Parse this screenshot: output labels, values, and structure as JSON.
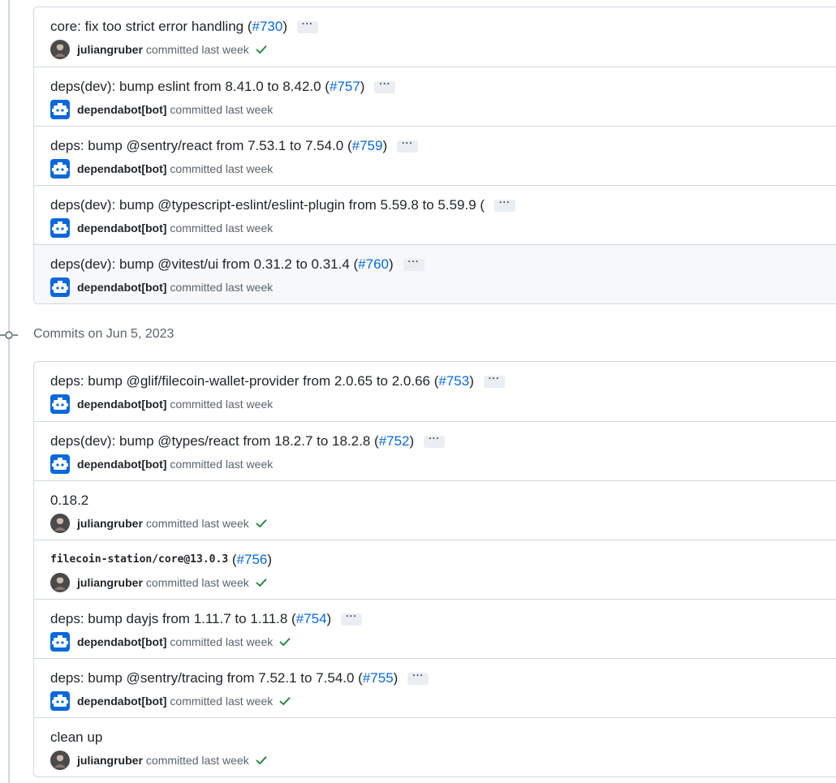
{
  "groups": [
    {
      "header": "",
      "commits": [
        {
          "title": "core: fix too strict error handling (",
          "pr": "#730",
          "close": ")",
          "author": "juliangruber",
          "avatar": "user",
          "status": "committed last week",
          "check": true,
          "ellipsis": "···"
        },
        {
          "title": "deps(dev): bump eslint from 8.41.0 to 8.42.0 (",
          "pr": "#757",
          "close": ")",
          "author": "dependabot[bot]",
          "avatar": "bot",
          "status": "committed last week",
          "check": false,
          "ellipsis": "···"
        },
        {
          "title": "deps: bump @sentry/react from 7.53.1 to 7.54.0 (",
          "pr": "#759",
          "close": ")",
          "author": "dependabot[bot]",
          "avatar": "bot",
          "status": "committed last week",
          "check": false,
          "ellipsis": "···"
        },
        {
          "title": "deps(dev): bump @typescript-eslint/eslint-plugin from 5.59.8 to 5.59.9 (",
          "pr": "",
          "close": "",
          "author": "dependabot[bot]",
          "avatar": "bot",
          "status": "committed last week",
          "check": false,
          "ellipsis": "···"
        },
        {
          "title": "deps(dev): bump @vitest/ui from 0.31.2 to 0.31.4 (",
          "pr": "#760",
          "close": ")",
          "author": "dependabot[bot]",
          "avatar": "bot",
          "status": "committed last week",
          "check": false,
          "ellipsis": "···",
          "hover": true
        }
      ]
    },
    {
      "header": "Commits on Jun 5, 2023",
      "commits": [
        {
          "title": "deps: bump @glif/filecoin-wallet-provider from 2.0.65 to 2.0.66 (",
          "pr": "#753",
          "close": ")",
          "author": "dependabot[bot]",
          "avatar": "bot",
          "status": "committed last week",
          "check": false,
          "ellipsis": "···"
        },
        {
          "title": "deps(dev): bump @types/react from 18.2.7 to 18.2.8 (",
          "pr": "#752",
          "close": ")",
          "author": "dependabot[bot]",
          "avatar": "bot",
          "status": "committed last week",
          "check": false,
          "ellipsis": "···"
        },
        {
          "title": "0.18.2",
          "pr": "",
          "close": "",
          "author": "juliangruber",
          "avatar": "user",
          "status": "committed last week",
          "check": true,
          "ellipsis": ""
        },
        {
          "title": "filecoin-station/core@13.0.3",
          "mono": true,
          "pre": " (",
          "pr": "#756",
          "close": ")",
          "author": "juliangruber",
          "avatar": "user",
          "status": "committed last week",
          "check": true,
          "ellipsis": ""
        },
        {
          "title": "deps: bump dayjs from 1.11.7 to 1.11.8 (",
          "pr": "#754",
          "close": ")",
          "author": "dependabot[bot]",
          "avatar": "bot",
          "status": "committed last week",
          "check": true,
          "ellipsis": "···"
        },
        {
          "title": "deps: bump @sentry/tracing from 7.52.1 to 7.54.0 (",
          "pr": "#755",
          "close": ")",
          "author": "dependabot[bot]",
          "avatar": "bot",
          "status": "committed last week",
          "check": true,
          "ellipsis": "···"
        },
        {
          "title": "clean up",
          "pr": "",
          "close": "",
          "author": "juliangruber",
          "avatar": "user",
          "status": "committed last week",
          "check": true,
          "ellipsis": ""
        }
      ]
    }
  ],
  "colors": {
    "link": "#0969da",
    "success": "#1a7f37",
    "bot": "#0969da"
  }
}
